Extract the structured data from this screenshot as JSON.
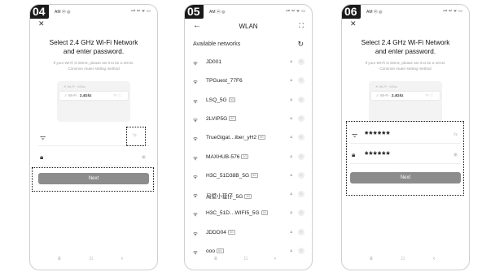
{
  "statusbar": {
    "left": "AM ⓦ ◎",
    "right": "ᵎᵎᵃˡ ᵃᵎˡ ᯤ ▭"
  },
  "panel1": {
    "step": "04",
    "title_line1": "Select 2.4 GHz Wi-Fi Network",
    "title_line2": "and enter password.",
    "sub_line1": "If your Wi-Fi is 5GHz, please set it to be 2.4GHz.",
    "sub_line2": "Common router setting method",
    "mini_row1": "✕ Wi-Fi · 5Ghz",
    "mini_row2_prefix": "✓ Wi-Fi · ",
    "mini_row2_bold": "2.4Ghz",
    "mini_row2_tail": "ᯤ ⓘ",
    "next_label": "Next"
  },
  "panel2": {
    "step": "05",
    "title": "WLAN",
    "available": "Available networks",
    "networks": [
      {
        "name": "JD001",
        "tag": ""
      },
      {
        "name": "TPGuest_77F6",
        "tag": ""
      },
      {
        "name": "LSQ_5G",
        "tag": "5G"
      },
      {
        "name": "2LVIP5G",
        "tag": "5G"
      },
      {
        "name": "TrueGigat…iber_yH2",
        "tag": "5G"
      },
      {
        "name": "MAXHUB-576",
        "tag": "5G"
      },
      {
        "name": "H3C_51D38B_5G",
        "tag": "5G"
      },
      {
        "name": "局壁小菝仔_5G",
        "tag": "5G"
      },
      {
        "name": "H3C_51D…WIFI5_5G",
        "tag": "5G"
      },
      {
        "name": "JDDD04",
        "tag": "5G"
      },
      {
        "name": "ooo",
        "tag": "5G"
      }
    ]
  },
  "panel3": {
    "step": "06",
    "title_line1": "Select 2.4 GHz Wi-Fi Network",
    "title_line2": "and enter password.",
    "sub_line1": "If your Wi-Fi is 5GHz, please set it to be 2.4GHz.",
    "sub_line2": "Common router setting method",
    "mini_row1": "✕ Wi-Fi · 5Ghz",
    "mini_row2_prefix": "✓ Wi-Fi · ",
    "mini_row2_bold": "2.4Ghz",
    "mini_row2_tail": "ᯤ ⓘ",
    "wifi_value": "******",
    "password_value": "******",
    "next_label": "Next"
  },
  "nav": {
    "menu": "≡",
    "home": "□",
    "back": "‹"
  }
}
